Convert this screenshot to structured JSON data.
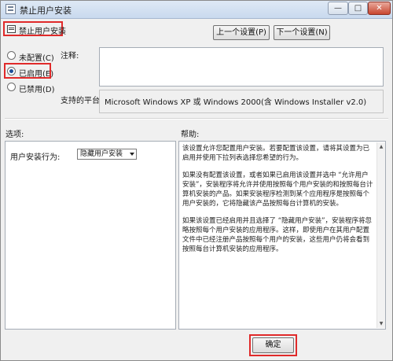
{
  "window": {
    "title": "禁止用户安装",
    "minimize_glyph": "—",
    "maximize_glyph": "□",
    "close_glyph": "✕"
  },
  "policy": {
    "name": "禁止用户安装",
    "prev_button": "上一个设置(P)",
    "next_button": "下一个设置(N)"
  },
  "state": {
    "options": [
      {
        "label": "未配置(C)",
        "checked": false
      },
      {
        "label": "已启用(E)",
        "checked": true
      },
      {
        "label": "已禁用(D)",
        "checked": false
      }
    ]
  },
  "comment": {
    "label": "注释:",
    "value": ""
  },
  "platform": {
    "label": "支持的平台:",
    "value": "Microsoft Windows XP 或 Windows 2000(含 Windows Installer v2.0)"
  },
  "options_section": {
    "label": "选项:",
    "field_label": "用户安装行为:",
    "select_value": "隐藏用户安装"
  },
  "help_section": {
    "label": "帮助:",
    "paragraphs": [
      "该设置允许您配置用户安装。若要配置该设置，请将其设置为已启用并使用下拉列表选择您希望的行为。",
      "如果没有配置该设置，或者如果已启用该设置并选中 “允许用户安装”，安装程序将允许并使用按照每个用户安装的和按照每台计算机安装的产品。如果安装程序检测到某个应用程序是按照每个用户安装的，它将隐藏该产品按照每台计算机的安装。",
      "如果该设置已经启用并且选择了 “隐藏用户安装”，安装程序将忽略按照每个用户安装的应用程序。这样，即使用户在其用户配置文件中已经注册产品按照每个用户的安装，这些用户仍将会看到按照每台计算机安装的应用程序。"
    ]
  },
  "footer": {
    "ok_button": "确定"
  },
  "colors": {
    "highlight_outline": "#e02a2a"
  }
}
